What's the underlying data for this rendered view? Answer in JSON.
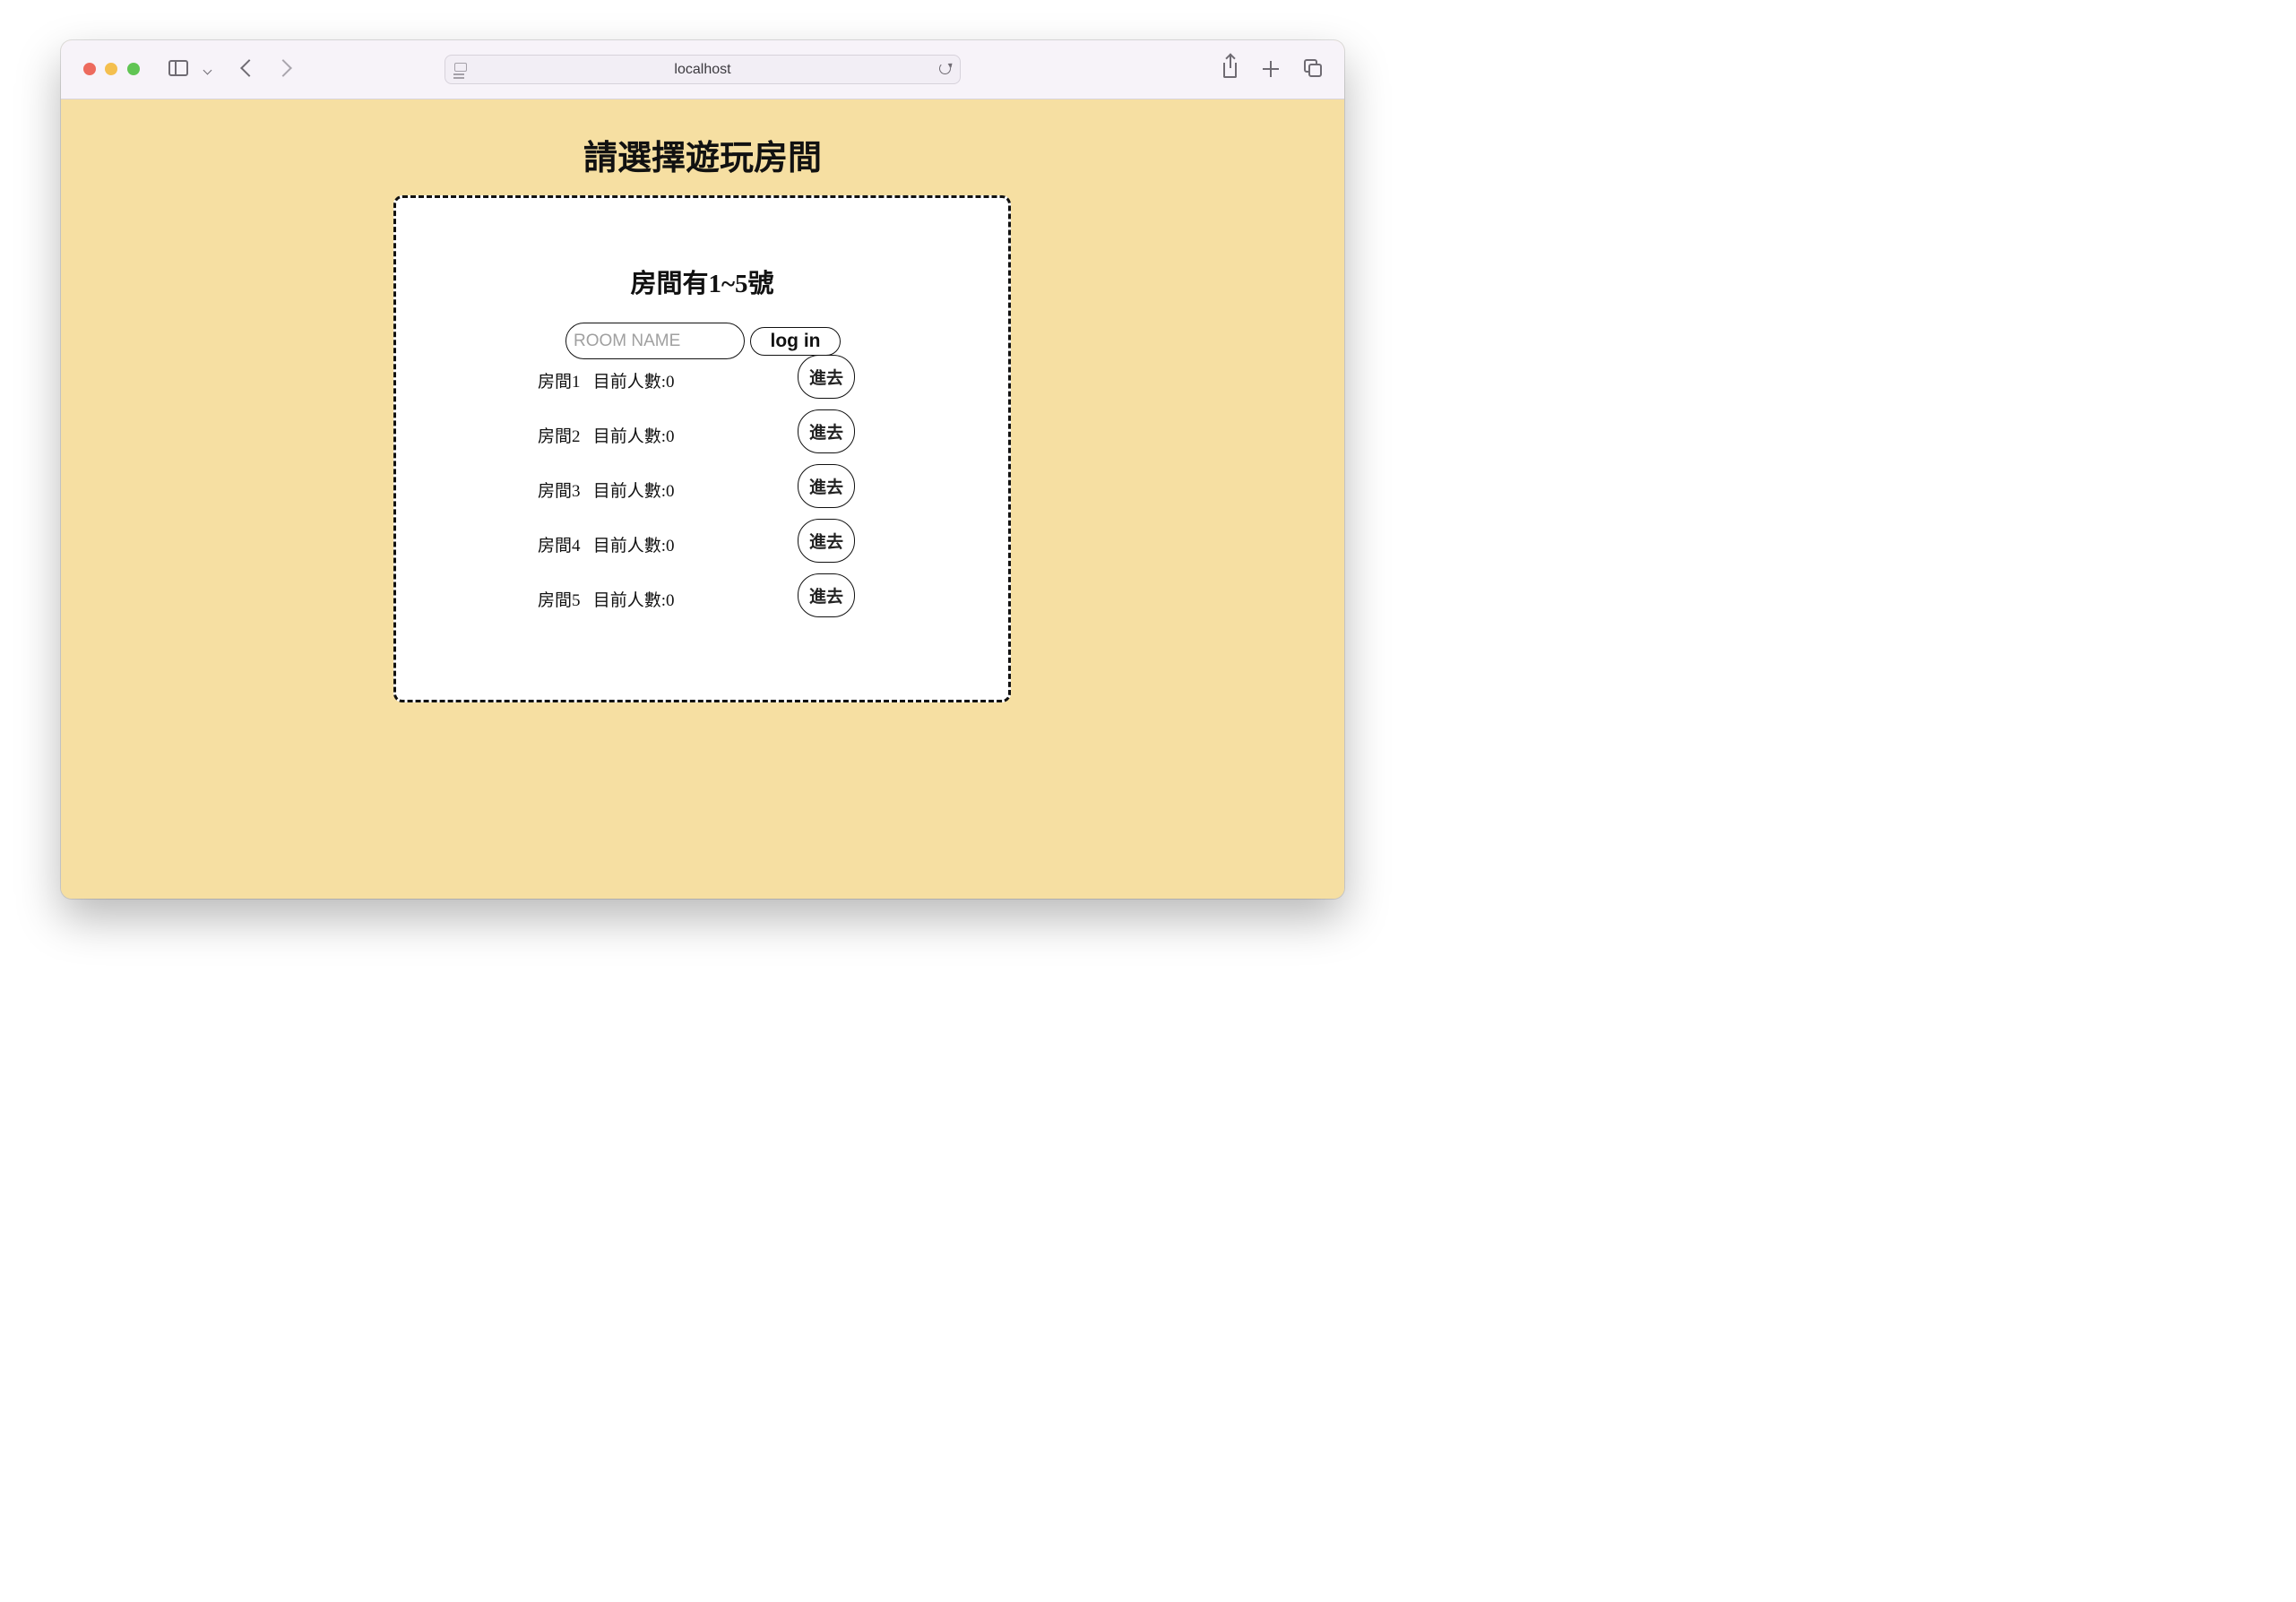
{
  "browser": {
    "url": "localhost"
  },
  "page": {
    "title": "請選擇遊玩房間",
    "card": {
      "heading": "房間有1~5號",
      "room_input": {
        "placeholder": "ROOM NAME",
        "value": ""
      },
      "login_label": "log in",
      "rooms": [
        {
          "label": "房間1   目前人數:0",
          "button": "進去"
        },
        {
          "label": "房間2   目前人數:0",
          "button": "進去"
        },
        {
          "label": "房間3   目前人數:0",
          "button": "進去"
        },
        {
          "label": "房間4   目前人數:0",
          "button": "進去"
        },
        {
          "label": "房間5   目前人數:0",
          "button": "進去"
        }
      ]
    }
  },
  "colors": {
    "page_background": "#f6dfa2",
    "card_background": "#ffffff",
    "card_border": "#111111"
  }
}
